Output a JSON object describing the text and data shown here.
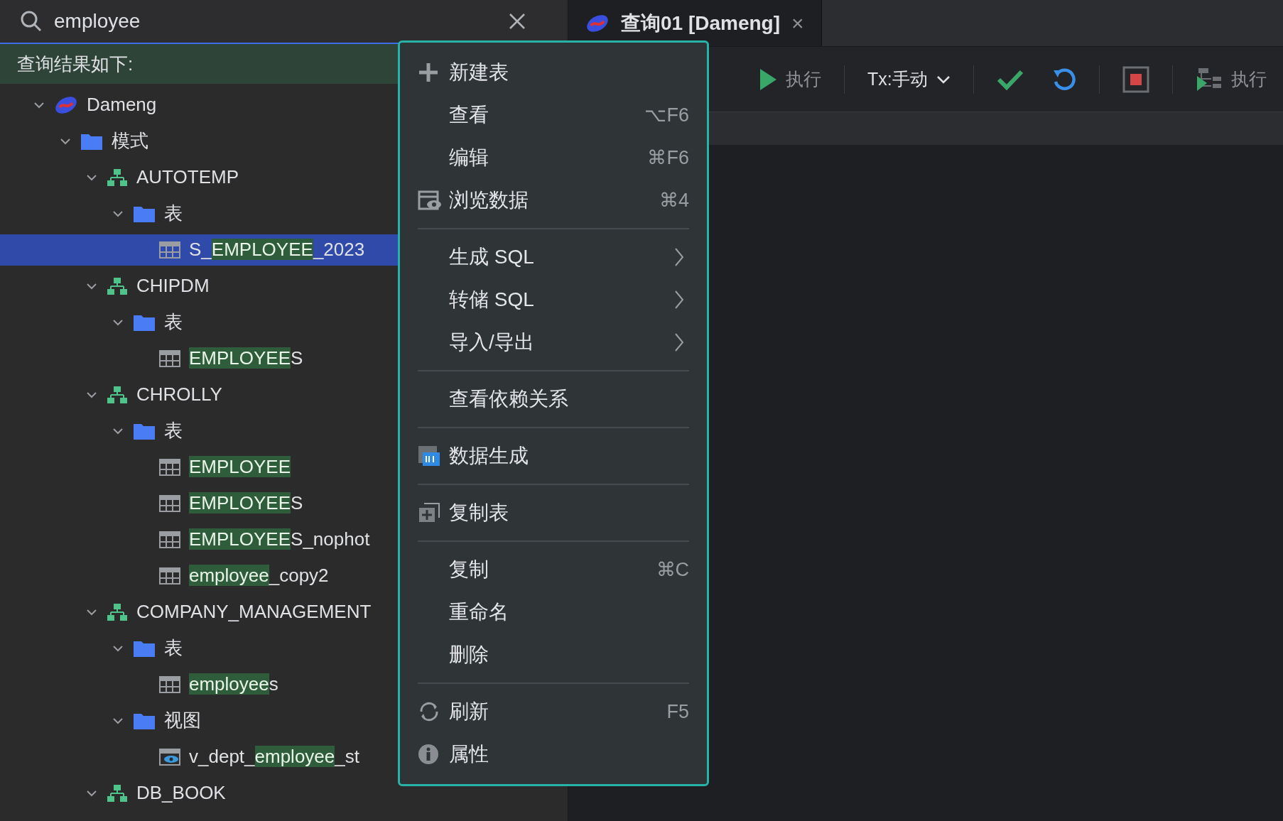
{
  "search": {
    "value": "employee"
  },
  "results_header": "查询结果如下:",
  "tree": [
    {
      "kind": "connection",
      "expanded": true,
      "selected": false,
      "segments": [
        {
          "text": "Dameng",
          "match": false
        }
      ],
      "children": [
        {
          "kind": "folder",
          "expanded": true,
          "selected": false,
          "segments": [
            {
              "text": "模式",
              "match": false
            }
          ],
          "children": [
            {
              "kind": "schema",
              "expanded": true,
              "selected": false,
              "segments": [
                {
                  "text": "AUTOTEMP",
                  "match": false
                }
              ],
              "children": [
                {
                  "kind": "folder",
                  "expanded": true,
                  "selected": false,
                  "segments": [
                    {
                      "text": "表",
                      "match": false
                    }
                  ],
                  "children": [
                    {
                      "kind": "table",
                      "selected": true,
                      "segments": [
                        {
                          "text": "S_",
                          "match": false
                        },
                        {
                          "text": "EMPLOYEE",
                          "match": true
                        },
                        {
                          "text": "_2023",
                          "match": false
                        }
                      ]
                    }
                  ]
                }
              ]
            },
            {
              "kind": "schema",
              "expanded": true,
              "selected": false,
              "segments": [
                {
                  "text": "CHIPDM",
                  "match": false
                }
              ],
              "children": [
                {
                  "kind": "folder",
                  "expanded": true,
                  "selected": false,
                  "segments": [
                    {
                      "text": "表",
                      "match": false
                    }
                  ],
                  "children": [
                    {
                      "kind": "table",
                      "selected": false,
                      "segments": [
                        {
                          "text": "EMPLOYEE",
                          "match": true
                        },
                        {
                          "text": "S",
                          "match": false
                        }
                      ]
                    }
                  ]
                }
              ]
            },
            {
              "kind": "schema",
              "expanded": true,
              "selected": false,
              "segments": [
                {
                  "text": "CHROLLY",
                  "match": false
                }
              ],
              "children": [
                {
                  "kind": "folder",
                  "expanded": true,
                  "selected": false,
                  "segments": [
                    {
                      "text": "表",
                      "match": false
                    }
                  ],
                  "children": [
                    {
                      "kind": "table",
                      "selected": false,
                      "segments": [
                        {
                          "text": "EMPLOYEE",
                          "match": true
                        }
                      ]
                    },
                    {
                      "kind": "table",
                      "selected": false,
                      "segments": [
                        {
                          "text": "EMPLOYEE",
                          "match": true
                        },
                        {
                          "text": "S",
                          "match": false
                        }
                      ]
                    },
                    {
                      "kind": "table",
                      "selected": false,
                      "segments": [
                        {
                          "text": "EMPLOYEE",
                          "match": true
                        },
                        {
                          "text": "S_nophot",
                          "match": false
                        }
                      ]
                    },
                    {
                      "kind": "table",
                      "selected": false,
                      "segments": [
                        {
                          "text": "employee",
                          "match": true
                        },
                        {
                          "text": "_copy2",
                          "match": false
                        }
                      ]
                    }
                  ]
                }
              ]
            },
            {
              "kind": "schema",
              "expanded": true,
              "selected": false,
              "segments": [
                {
                  "text": "COMPANY_MANAGEMENT",
                  "match": false
                }
              ],
              "children": [
                {
                  "kind": "folder",
                  "expanded": true,
                  "selected": false,
                  "segments": [
                    {
                      "text": "表",
                      "match": false
                    }
                  ],
                  "children": [
                    {
                      "kind": "table",
                      "selected": false,
                      "segments": [
                        {
                          "text": "employee",
                          "match": true
                        },
                        {
                          "text": "s",
                          "match": false
                        }
                      ]
                    }
                  ]
                },
                {
                  "kind": "folder",
                  "expanded": true,
                  "selected": false,
                  "segments": [
                    {
                      "text": "视图",
                      "match": false
                    }
                  ],
                  "children": [
                    {
                      "kind": "view",
                      "selected": false,
                      "segments": [
                        {
                          "text": "v_dept_",
                          "match": false
                        },
                        {
                          "text": "employee",
                          "match": true
                        },
                        {
                          "text": "_st",
                          "match": false
                        }
                      ]
                    }
                  ]
                }
              ]
            },
            {
              "kind": "schema",
              "expanded": true,
              "selected": false,
              "segments": [
                {
                  "text": "DB_BOOK",
                  "match": false
                }
              ]
            }
          ]
        }
      ]
    }
  ],
  "tab": {
    "title": "查询01 [Dameng]",
    "close": "×"
  },
  "toolbar": [
    {
      "kind": "run",
      "label": "执行"
    },
    {
      "kind": "dropdown",
      "label": "Tx:手动"
    },
    {
      "kind": "commit"
    },
    {
      "kind": "rollback"
    },
    {
      "kind": "stop"
    },
    {
      "kind": "plan",
      "label": "执行"
    }
  ],
  "context_menu": [
    {
      "kind": "create",
      "label": "新建表"
    },
    {
      "kind": "item",
      "label": "查看",
      "shortcut": "⌥F6"
    },
    {
      "kind": "item",
      "label": "编辑",
      "shortcut": "⌘F6"
    },
    {
      "kind": "browse",
      "label": "浏览数据",
      "shortcut": "⌘4"
    },
    {
      "kind": "separator"
    },
    {
      "kind": "item",
      "label": "生成 SQL",
      "submenu": true
    },
    {
      "kind": "item",
      "label": "转储 SQL",
      "submenu": true
    },
    {
      "kind": "item",
      "label": "导入/导出",
      "submenu": true
    },
    {
      "kind": "separator"
    },
    {
      "kind": "item",
      "label": "查看依赖关系"
    },
    {
      "kind": "separator"
    },
    {
      "kind": "datagen",
      "label": "数据生成"
    },
    {
      "kind": "separator"
    },
    {
      "kind": "copytable",
      "label": "复制表"
    },
    {
      "kind": "separator"
    },
    {
      "kind": "item",
      "label": "复制",
      "shortcut": "⌘C"
    },
    {
      "kind": "item",
      "label": "重命名"
    },
    {
      "kind": "item",
      "label": "删除"
    },
    {
      "kind": "separator"
    },
    {
      "kind": "refresh",
      "label": "刷新",
      "shortcut": "F5"
    },
    {
      "kind": "info",
      "label": "属性"
    }
  ]
}
